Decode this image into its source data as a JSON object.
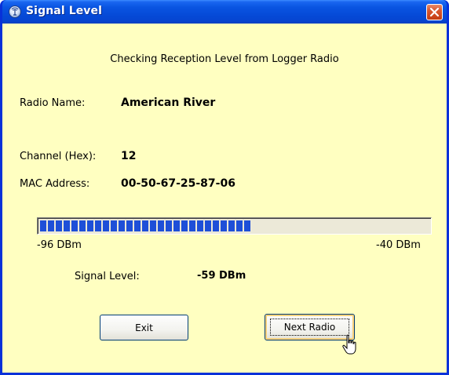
{
  "window": {
    "title": "Signal Level",
    "title_icon": "radio-tower-icon",
    "close_icon": "close-icon"
  },
  "dialog": {
    "heading": "Checking Reception Level from Logger Radio",
    "radio_name_label": "Radio Name:",
    "radio_name_value": "American River",
    "channel_label": "Channel (Hex):",
    "channel_value": "12",
    "mac_label": "MAC Address:",
    "mac_value": "00-50-67-25-87-06"
  },
  "meter": {
    "min_label": "-96 DBm",
    "max_label": "-40 DBm",
    "min_dbm": -96,
    "max_dbm": -40,
    "level_dbm": -59,
    "segment_count": 27,
    "fill_color": "#1e4fd8"
  },
  "signal": {
    "label": "Signal Level:",
    "value": "-59 DBm"
  },
  "buttons": {
    "exit_label": "Exit",
    "next_label": "Next Radio"
  },
  "colors": {
    "background": "#ffffc1",
    "titlebar": "#0a55e2"
  }
}
